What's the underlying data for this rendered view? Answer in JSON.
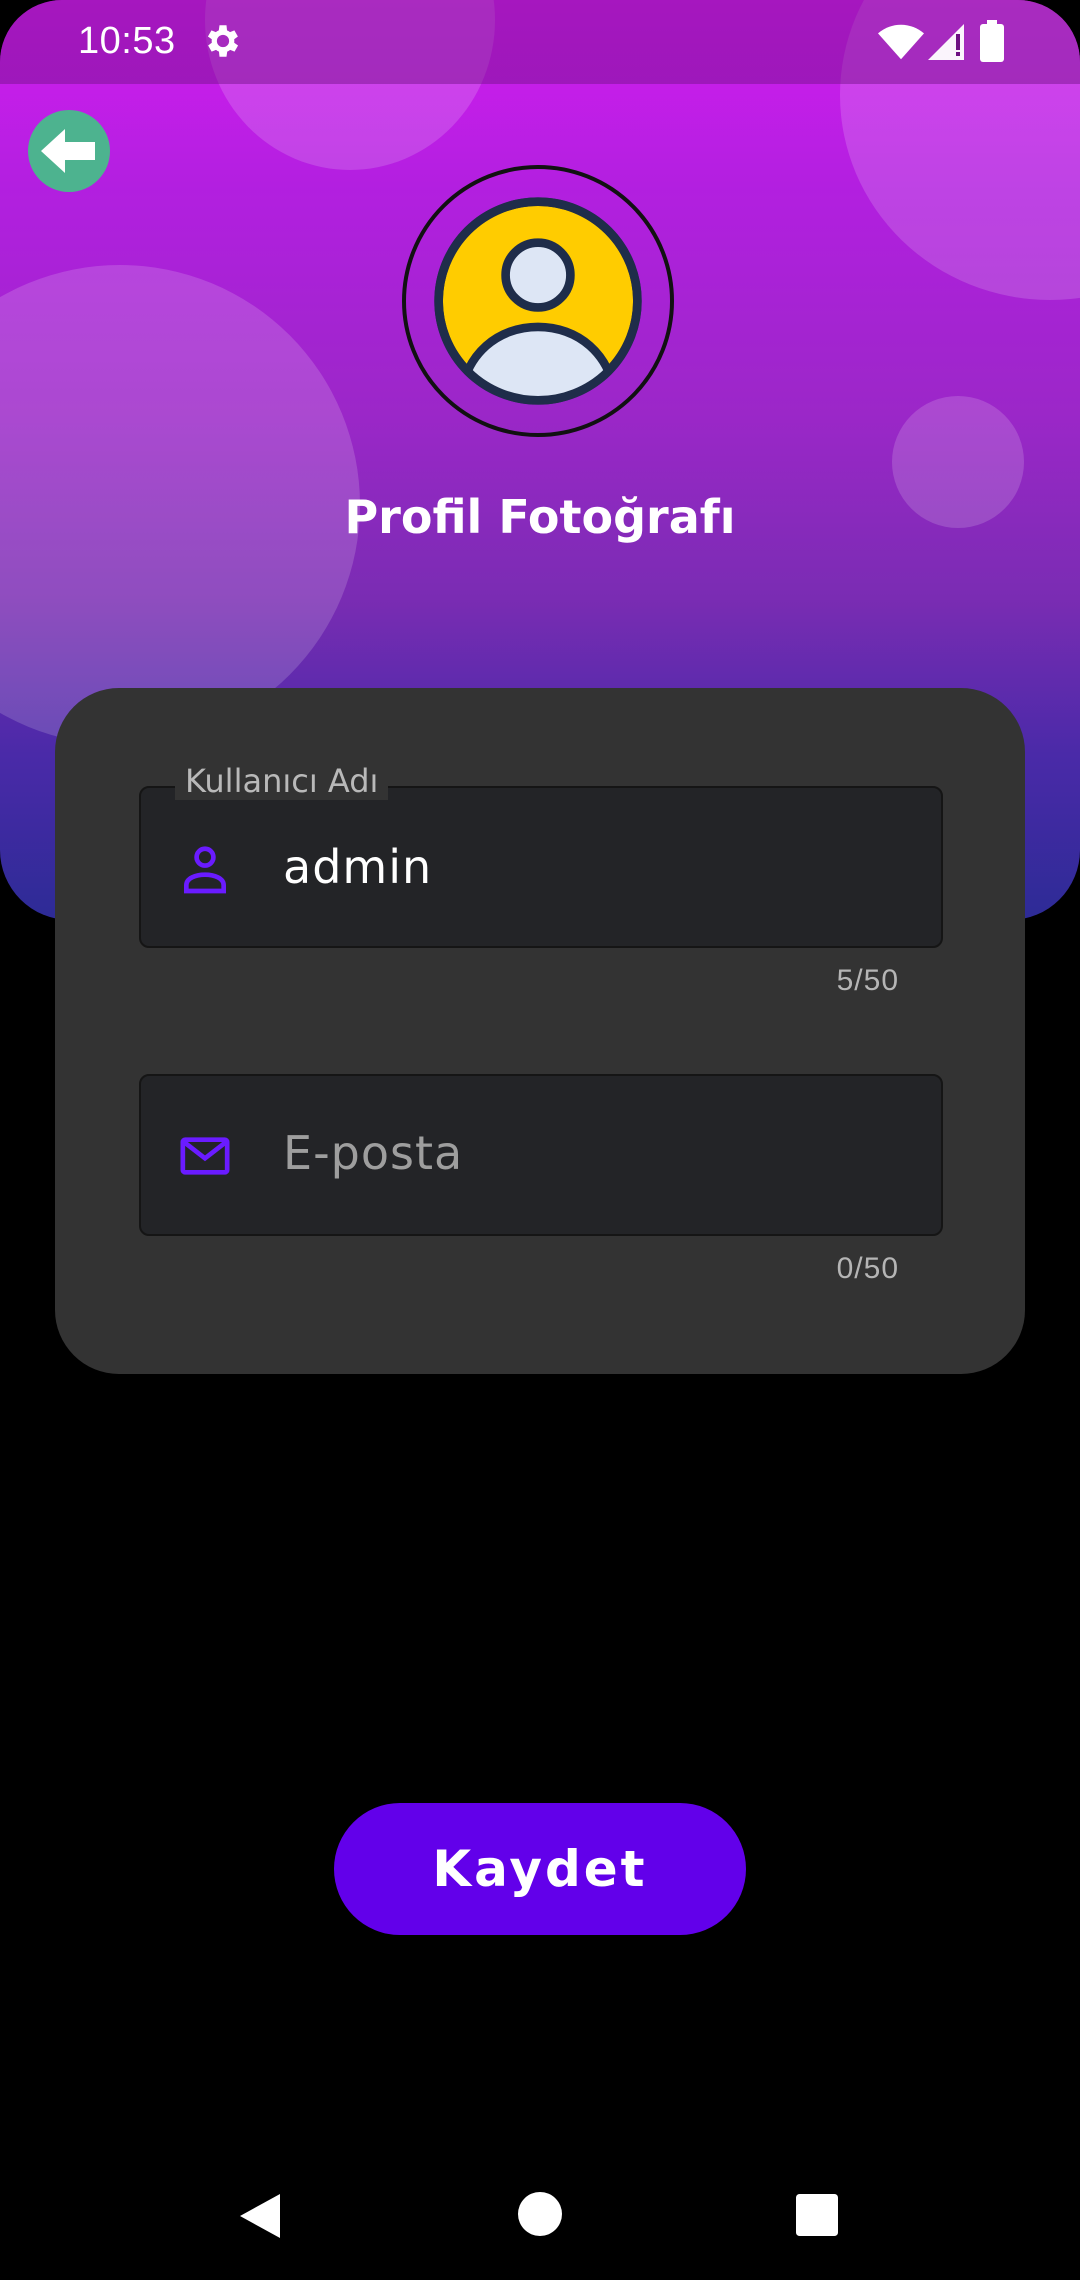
{
  "status_bar": {
    "time": "10:53",
    "icons": [
      "settings-icon",
      "wifi-icon",
      "signal-icon",
      "battery-icon"
    ]
  },
  "header": {
    "back_icon": "arrow-left-icon",
    "avatar_icon": "user-avatar-icon",
    "title": "Profil Fotoğrafı"
  },
  "form": {
    "username": {
      "label": "Kullanıcı Adı",
      "value": "admin",
      "counter": "5/50",
      "icon": "person-icon"
    },
    "email": {
      "placeholder": "E-posta",
      "value": "",
      "counter": "0/50",
      "icon": "mail-icon"
    }
  },
  "actions": {
    "save_label": "Kaydet"
  },
  "nav_bar": {
    "icons": [
      "back-triangle-icon",
      "home-circle-icon",
      "recents-square-icon"
    ]
  },
  "colors": {
    "accent": "#6200ea",
    "back_button": "#4db38f",
    "card": "#333333",
    "field": "#232427",
    "avatar_yellow": "#ffcc00"
  }
}
